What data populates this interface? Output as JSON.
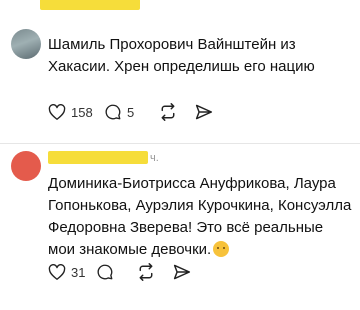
{
  "comments": [
    {
      "text": "Шамиль Прохорович Вайнштейн из Хакасии. Хрен определишь его нацию",
      "likes": "158",
      "replies": "5",
      "meta": ""
    },
    {
      "text": "Доминика-Биотрисса Ануфрикова, Лаура Гопонькова, Аурэлия Курочкина, Консуэлла Федоровна Зверева! Это всё реальные мои знакомые девочки.",
      "likes": "31",
      "replies": "",
      "meta": "ч."
    }
  ],
  "icons": {
    "like": "heart-icon",
    "reply": "comment-bubble-icon",
    "repost": "repost-arrows-icon",
    "share": "send-paper-plane-icon",
    "emoji": "winking-face-emoji"
  },
  "colors": {
    "redaction": "#f6dd3a"
  }
}
